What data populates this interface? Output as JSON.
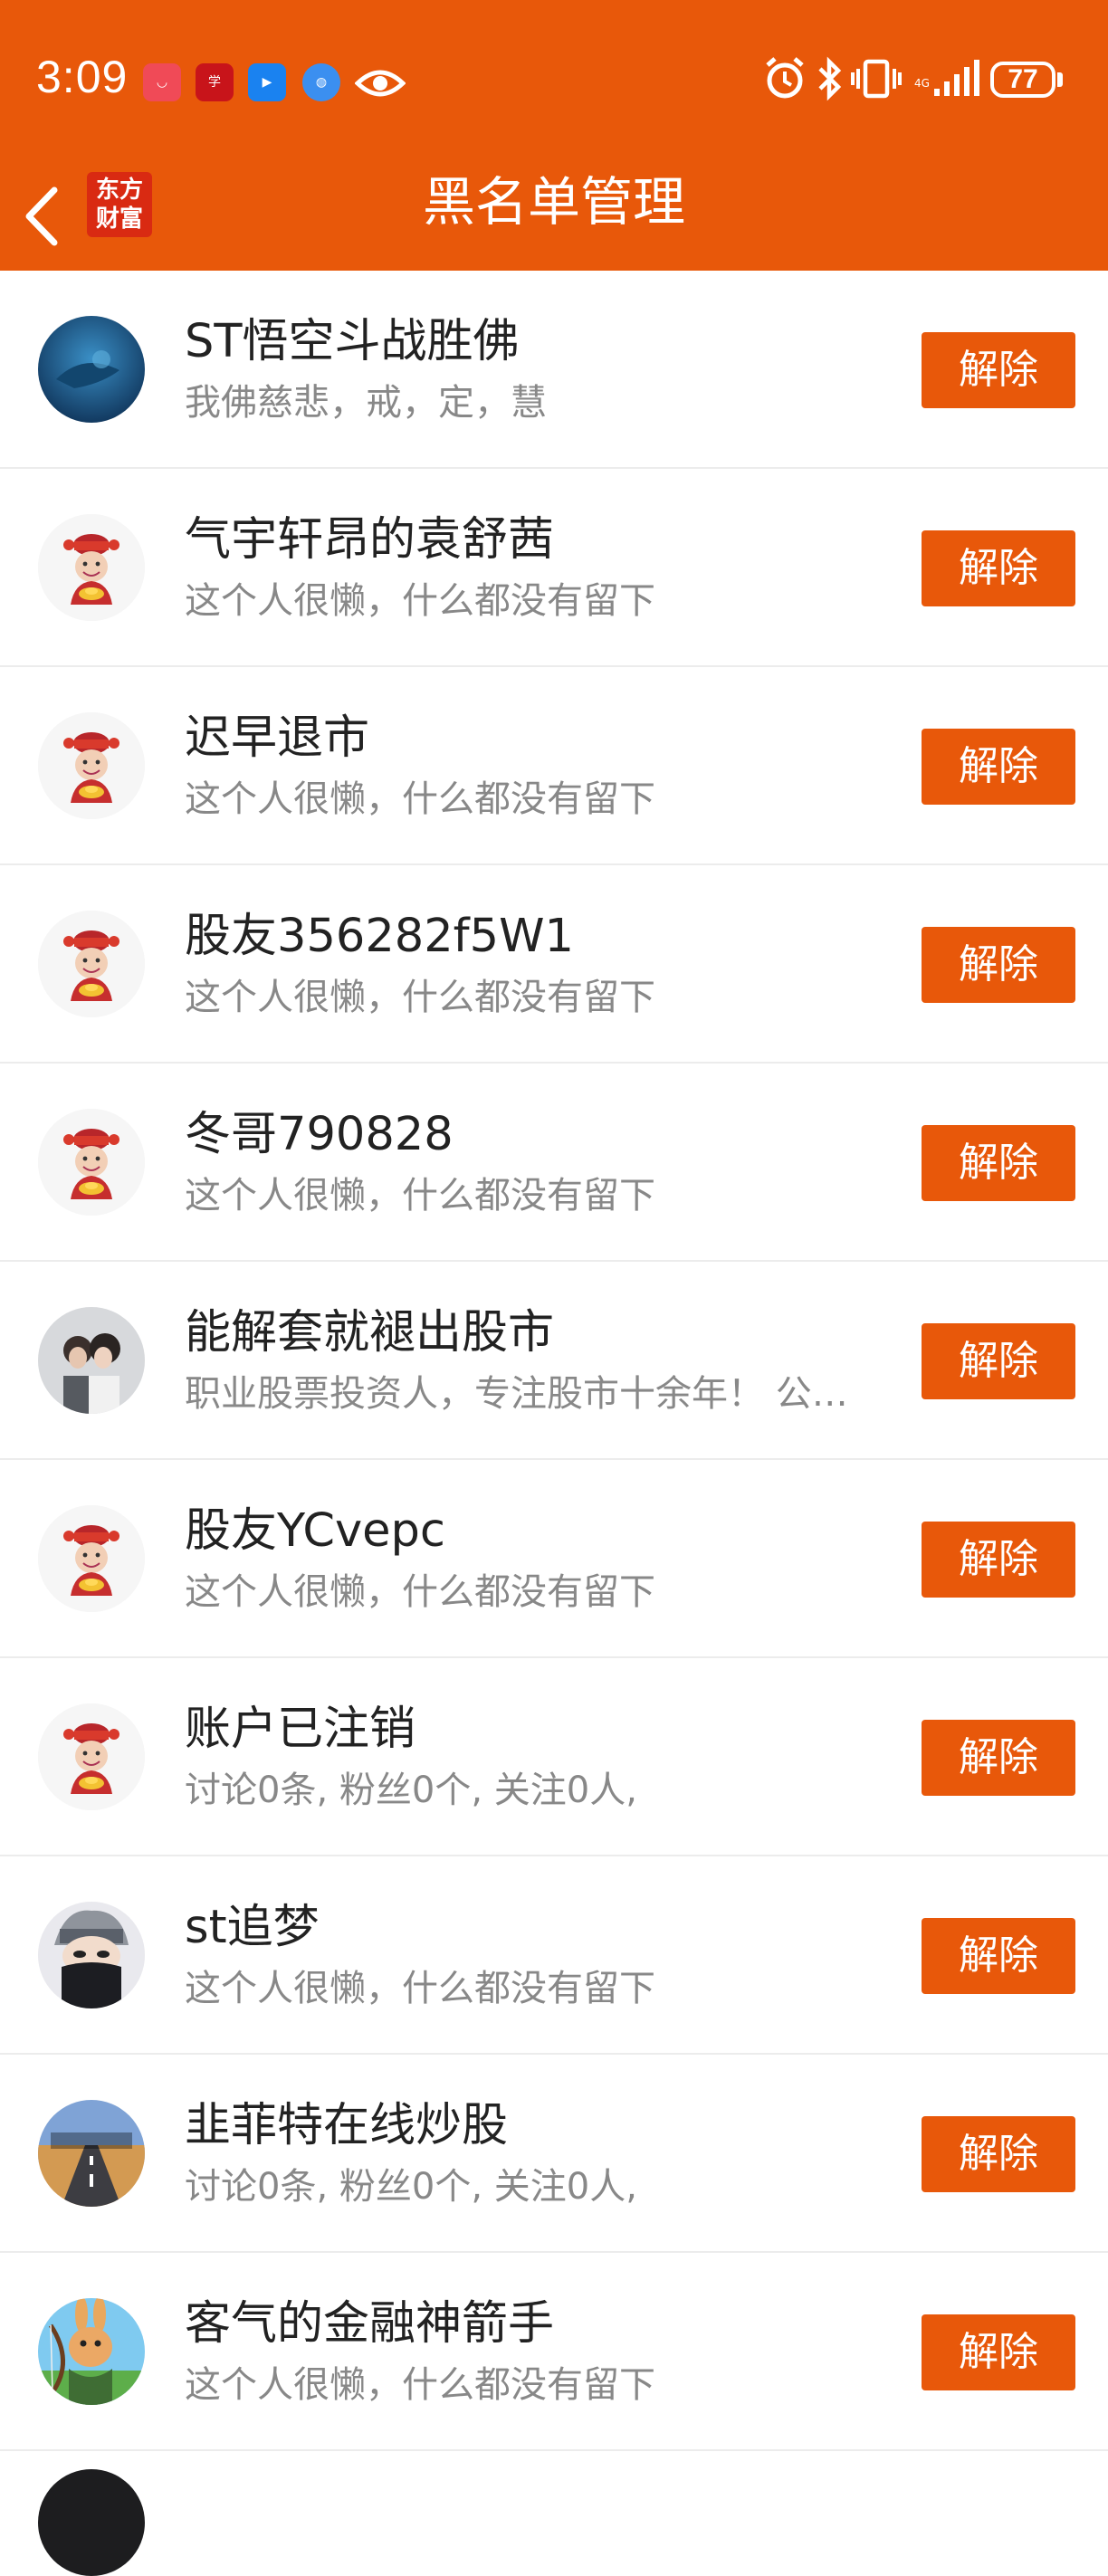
{
  "status_bar": {
    "time": "3:09",
    "battery": "77",
    "notification_icons": [
      "huawei-appgallery-icon",
      "xuexi-app-icon",
      "navigation-app-icon",
      "browser-app-icon",
      "eye-comfort-icon"
    ],
    "status_icons": [
      "alarm-icon",
      "bluetooth-icon",
      "vibrate-icon",
      "signal-icon",
      "battery-icon"
    ]
  },
  "navbar": {
    "brand_line1": "东方",
    "brand_line2": "财富",
    "title": "黑名单管理"
  },
  "colors": {
    "accent": "#e8580a",
    "name": "#222222",
    "desc": "#888888",
    "divider": "#ececec"
  },
  "blacklist": [
    {
      "name": "ST悟空斗战胜佛",
      "desc": "我佛慈悲，戒，定，慧",
      "avatar": "ocean-photo-avatar",
      "button": "解除"
    },
    {
      "name": "气宇轩昂的袁舒茜",
      "desc": "这个人很懒，什么都没有留下",
      "avatar": "caishen-default-avatar",
      "button": "解除"
    },
    {
      "name": "迟早退市",
      "desc": "这个人很懒，什么都没有留下",
      "avatar": "caishen-default-avatar",
      "button": "解除"
    },
    {
      "name": "股友356282f5W1",
      "desc": "这个人很懒，什么都没有留下",
      "avatar": "caishen-default-avatar",
      "button": "解除"
    },
    {
      "name": "冬哥790828",
      "desc": "这个人很懒，什么都没有留下",
      "avatar": "caishen-default-avatar",
      "button": "解除"
    },
    {
      "name": "能解套就褪出股市",
      "desc": " 职业股票投资人，专注股市十余年！ 公…",
      "avatar": "couple-photo-avatar",
      "button": "解除"
    },
    {
      "name": "股友YCvepc",
      "desc": "这个人很懒，什么都没有留下",
      "avatar": "caishen-default-avatar",
      "button": "解除"
    },
    {
      "name": "账户已注销",
      "desc": "讨论0条, 粉丝0个, 关注0人,",
      "avatar": "caishen-default-avatar",
      "button": "解除"
    },
    {
      "name": "st追梦",
      "desc": "这个人很懒，什么都没有留下",
      "avatar": "ninja-anime-avatar",
      "button": "解除"
    },
    {
      "name": "韭菲特在线炒股",
      "desc": "讨论0条, 粉丝0个, 关注0人,",
      "avatar": "road-photo-avatar",
      "button": "解除"
    },
    {
      "name": "客气的金融神箭手",
      "desc": "这个人很懒，什么都没有留下",
      "avatar": "archer-rabbit-avatar",
      "button": "解除"
    }
  ]
}
